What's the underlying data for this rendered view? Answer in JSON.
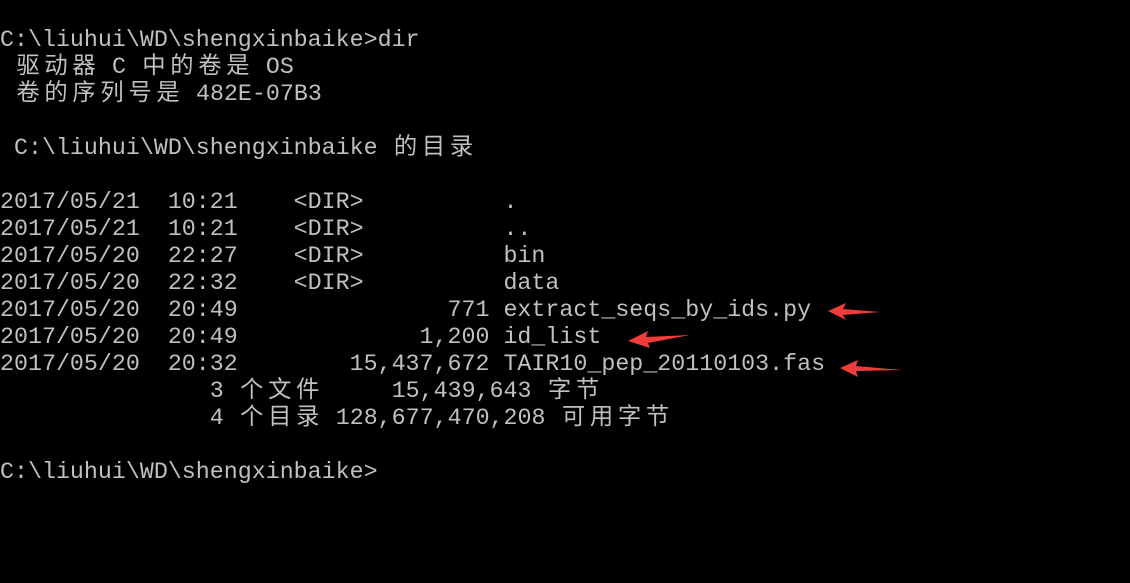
{
  "terminal": {
    "prompt_command": "C:\\liuhui\\WD\\shengxinbaike>dir",
    "volume_line": " 驱动器 C 中的卷是 OS",
    "serial_line": " 卷的序列号是 482E-07B3",
    "directory_header": " C:\\liuhui\\WD\\shengxinbaike 的目录",
    "entries": [
      "2017/05/21  10:21    <DIR>          .",
      "2017/05/21  10:21    <DIR>          ..",
      "2017/05/20  22:27    <DIR>          bin",
      "2017/05/20  22:32    <DIR>          data",
      "2017/05/20  20:49               771 extract_seqs_by_ids.py",
      "2017/05/20  20:49             1,200 id_list",
      "2017/05/20  20:32        15,437,672 TAIR10_pep_20110103.fas"
    ],
    "files_summary": "               3 个文件     15,439,643 字节",
    "dirs_summary": "               4 个目录 128,677,470,208 可用字节",
    "final_prompt": "C:\\liuhui\\WD\\shengxinbaike>"
  },
  "colors": {
    "text": "#c0c0c0",
    "background": "#000000",
    "annotation_arrow": "#f03c3c"
  }
}
